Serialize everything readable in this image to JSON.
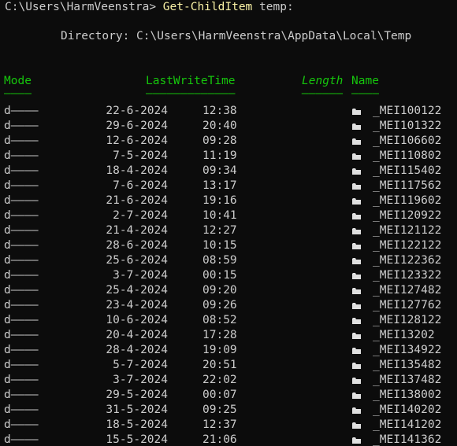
{
  "prompt": {
    "path": "C:\\Users\\HarmVeenstra>",
    "command": "Get-ChildItem",
    "argument": "temp:"
  },
  "directory_header": {
    "label": "Directory:",
    "path": "C:\\Users\\HarmVeenstra\\AppData\\Local\\Temp"
  },
  "columns": {
    "mode": "Mode",
    "lastwritetime": "LastWriteTime",
    "length": "Length",
    "name": "Name",
    "mode_rule": "————",
    "lastwritetime_rule": "—————————————",
    "length_rule": "——————",
    "name_rule": "————"
  },
  "colors": {
    "background": "#0c0c0c",
    "text": "#cccccc",
    "command": "#f9f1a5",
    "header": "#16c60c"
  },
  "rows": [
    {
      "mode": "d————",
      "date": "22-6-2024",
      "time": "12:38",
      "icon": "folder-icon",
      "name": "_MEI100122"
    },
    {
      "mode": "d————",
      "date": "29-6-2024",
      "time": "20:40",
      "icon": "folder-icon",
      "name": "_MEI101322"
    },
    {
      "mode": "d————",
      "date": "12-6-2024",
      "time": "09:28",
      "icon": "folder-icon",
      "name": "_MEI106602"
    },
    {
      "mode": "d————",
      "date": "7-5-2024",
      "time": "11:19",
      "icon": "folder-icon",
      "name": "_MEI110802"
    },
    {
      "mode": "d————",
      "date": "18-4-2024",
      "time": "09:34",
      "icon": "folder-icon",
      "name": "_MEI115402"
    },
    {
      "mode": "d————",
      "date": "7-6-2024",
      "time": "13:17",
      "icon": "folder-icon",
      "name": "_MEI117562"
    },
    {
      "mode": "d————",
      "date": "21-6-2024",
      "time": "19:16",
      "icon": "folder-icon",
      "name": "_MEI119602"
    },
    {
      "mode": "d————",
      "date": "2-7-2024",
      "time": "10:41",
      "icon": "folder-icon",
      "name": "_MEI120922"
    },
    {
      "mode": "d————",
      "date": "21-4-2024",
      "time": "12:27",
      "icon": "folder-icon",
      "name": "_MEI121122"
    },
    {
      "mode": "d————",
      "date": "28-6-2024",
      "time": "10:15",
      "icon": "folder-icon",
      "name": "_MEI122122"
    },
    {
      "mode": "d————",
      "date": "25-6-2024",
      "time": "08:59",
      "icon": "folder-icon",
      "name": "_MEI122362"
    },
    {
      "mode": "d————",
      "date": "3-7-2024",
      "time": "00:15",
      "icon": "folder-icon",
      "name": "_MEI123322"
    },
    {
      "mode": "d————",
      "date": "25-4-2024",
      "time": "09:20",
      "icon": "folder-icon",
      "name": "_MEI127482"
    },
    {
      "mode": "d————",
      "date": "23-4-2024",
      "time": "09:26",
      "icon": "folder-icon",
      "name": "_MEI127762"
    },
    {
      "mode": "d————",
      "date": "10-6-2024",
      "time": "08:52",
      "icon": "folder-icon",
      "name": "_MEI128122"
    },
    {
      "mode": "d————",
      "date": "20-4-2024",
      "time": "17:28",
      "icon": "folder-icon",
      "name": "_MEI13202"
    },
    {
      "mode": "d————",
      "date": "28-4-2024",
      "time": "19:09",
      "icon": "folder-icon",
      "name": "_MEI134922"
    },
    {
      "mode": "d————",
      "date": "5-7-2024",
      "time": "20:51",
      "icon": "folder-icon",
      "name": "_MEI135482"
    },
    {
      "mode": "d————",
      "date": "3-7-2024",
      "time": "22:02",
      "icon": "folder-icon",
      "name": "_MEI137482"
    },
    {
      "mode": "d————",
      "date": "29-5-2024",
      "time": "00:07",
      "icon": "folder-icon",
      "name": "_MEI138002"
    },
    {
      "mode": "d————",
      "date": "31-5-2024",
      "time": "09:25",
      "icon": "folder-icon",
      "name": "_MEI140202"
    },
    {
      "mode": "d————",
      "date": "18-5-2024",
      "time": "12:37",
      "icon": "folder-icon",
      "name": "_MEI141202"
    },
    {
      "mode": "d————",
      "date": "15-5-2024",
      "time": "21:06",
      "icon": "folder-icon",
      "name": "_MEI141362"
    }
  ]
}
